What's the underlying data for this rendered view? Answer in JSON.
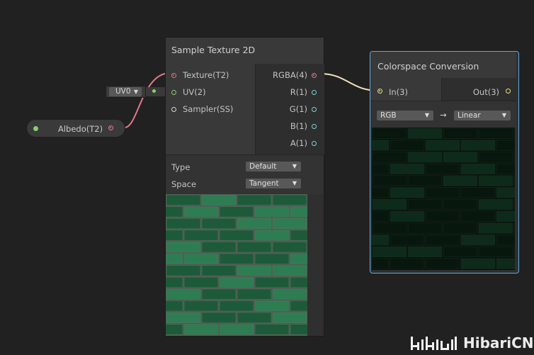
{
  "property": {
    "label": "Albedo(T2)"
  },
  "uv_inline": {
    "value": "UV0"
  },
  "sample_texture": {
    "title": "Sample Texture 2D",
    "inputs": [
      "Texture(T2)",
      "UV(2)",
      "Sampler(SS)"
    ],
    "outputs": [
      "RGBA(4)",
      "R(1)",
      "G(1)",
      "B(1)",
      "A(1)"
    ],
    "type_label": "Type",
    "type_value": "Default",
    "space_label": "Space",
    "space_value": "Tangent"
  },
  "colorspace": {
    "title": "Colorspace Conversion",
    "input": "In(3)",
    "output": "Out(3)",
    "from_value": "RGB",
    "arrow": "→",
    "to_value": "Linear"
  },
  "watermark": {
    "text": "HibariCN"
  },
  "colors": {
    "background": "#212121",
    "texture_port": "#e07a8a",
    "vector2_port": "#8bcf6a",
    "vector4_port": "#e6e083",
    "float_port": "#7fd0d6",
    "selected_outline": "#5fa6e0",
    "brick_light": "#2f7a4f",
    "brick_dark": "#0d2a1b"
  },
  "icons": [
    "dropdown-caret-icon",
    "arrow-right-icon"
  ]
}
